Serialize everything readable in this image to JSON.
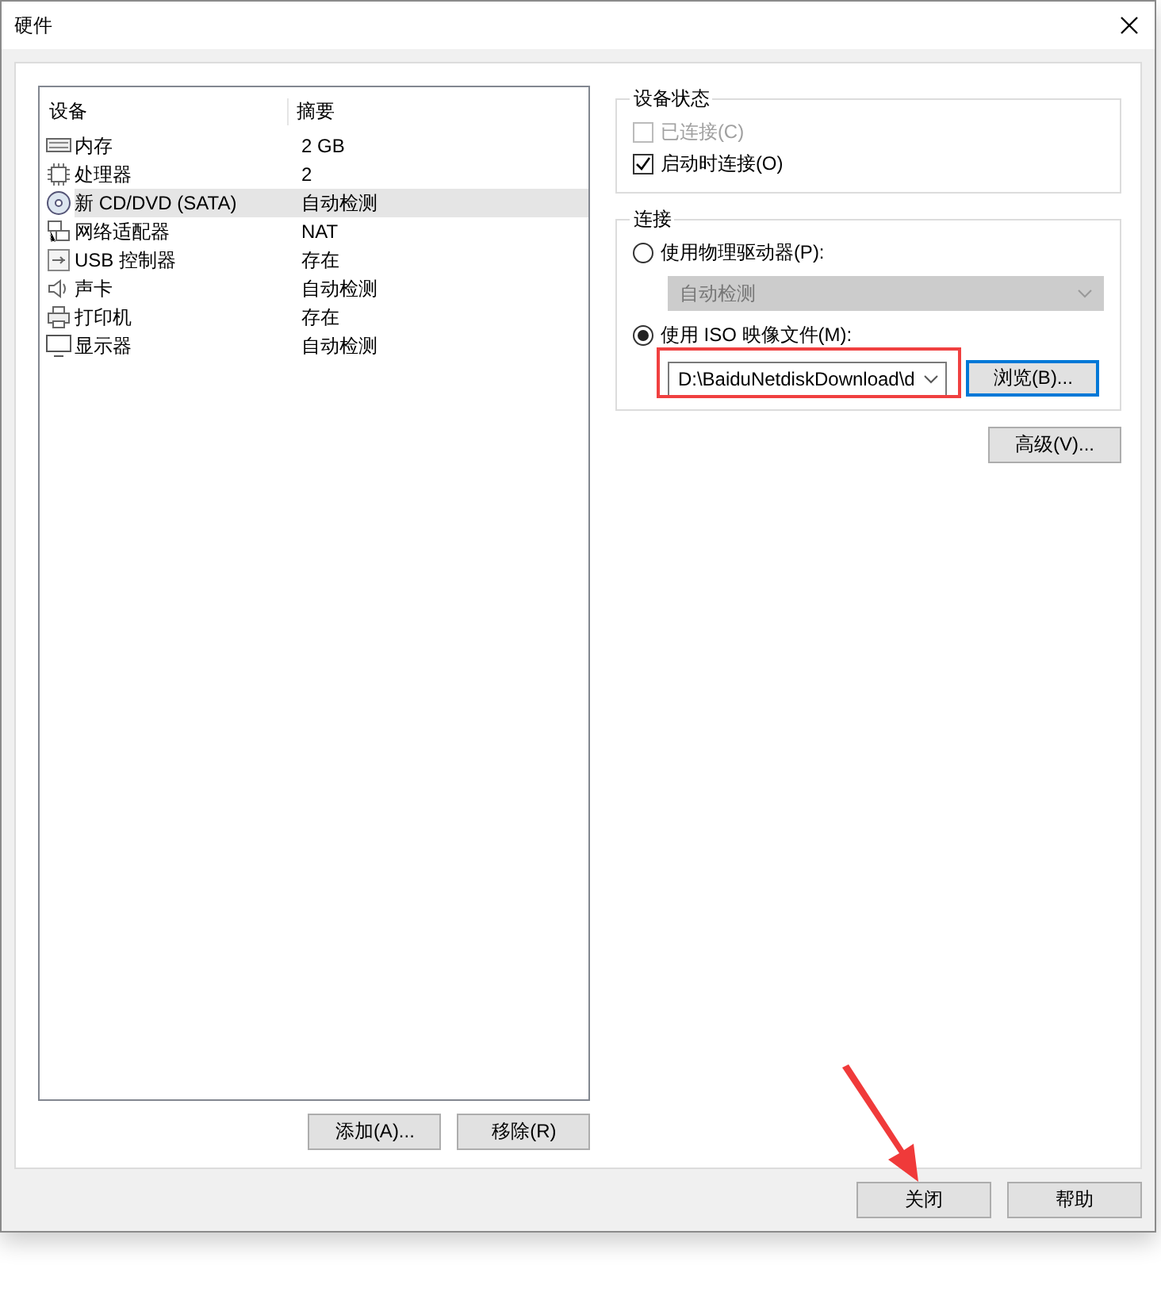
{
  "window": {
    "title": "硬件"
  },
  "device_list": {
    "columns": [
      "设备",
      "摘要"
    ],
    "rows": [
      {
        "device": "内存",
        "summary": "2 GB",
        "selected": false
      },
      {
        "device": "处理器",
        "summary": "2",
        "selected": false
      },
      {
        "device": "新 CD/DVD (SATA)",
        "summary": "自动检测",
        "selected": true
      },
      {
        "device": "网络适配器",
        "summary": "NAT",
        "selected": false
      },
      {
        "device": "USB 控制器",
        "summary": "存在",
        "selected": false
      },
      {
        "device": "声卡",
        "summary": "自动检测",
        "selected": false
      },
      {
        "device": "打印机",
        "summary": "存在",
        "selected": false
      },
      {
        "device": "显示器",
        "summary": "自动检测",
        "selected": false
      }
    ],
    "buttons": [
      "添加(A)...",
      "移除(R)"
    ]
  },
  "device_status": {
    "title": "设备状态",
    "options": [
      {
        "label": "已连接(C)",
        "checked": false,
        "disabled": true
      },
      {
        "label": "启动时连接(O)",
        "checked": true,
        "disabled": false
      }
    ]
  },
  "connection": {
    "title": "连接",
    "physical": {
      "label": "使用物理驱动器(P):",
      "selected": false,
      "dropdown": {
        "value": "自动检测",
        "disabled": true
      }
    },
    "iso": {
      "label": "使用 ISO 映像文件(M):",
      "selected": true,
      "path": "D:\\BaiduNetdiskDownload\\d",
      "browse": "浏览(B)..."
    }
  },
  "advanced_button": "高级(V)...",
  "footer_buttons": [
    "关闭",
    "帮助"
  ],
  "annotations": {
    "highlight_box": true,
    "pointer_arrow": true
  }
}
